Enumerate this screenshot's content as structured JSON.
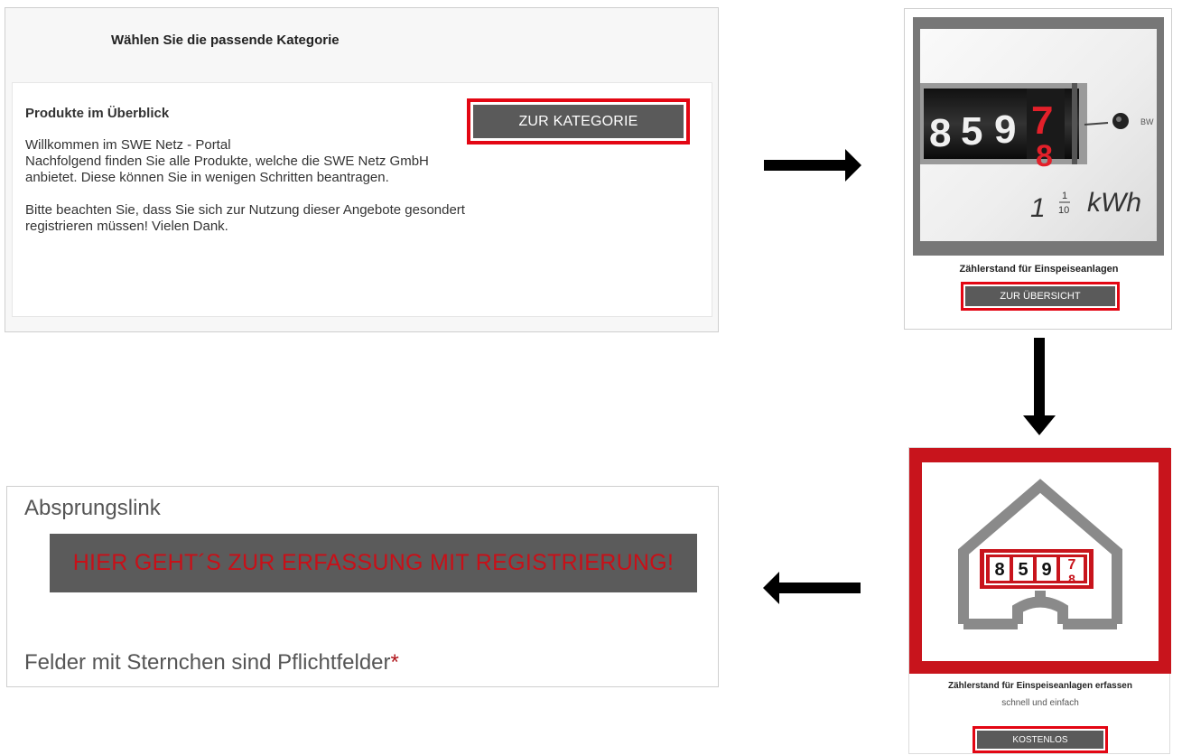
{
  "panel1": {
    "title": "Wählen Sie die passende Kategorie",
    "heading": "Produkte im Überblick",
    "body_line1": "Willkommen im SWE Netz - Portal",
    "body_line2": "Nachfolgend finden Sie alle Produkte, welche die SWE Netz GmbH anbietet. Diese können Sie in wenigen Schritten beantragen.",
    "body_para2": "Bitte beachten Sie, dass Sie sich zur Nutzung dieser Angebote gesondert registrieren müssen! Vielen Dank.",
    "button_label": "ZUR KATEGORIE"
  },
  "panel2": {
    "meter_digits": [
      "8",
      "5",
      "9",
      "7",
      "8"
    ],
    "meter_scale": [
      "1",
      "1",
      "10",
      "kWh"
    ],
    "caption": "Zählerstand für Einspeiseanlagen",
    "button_label": "ZUR ÜBERSICHT"
  },
  "panel3": {
    "meter_digits": [
      "8",
      "5",
      "9",
      "7",
      "8"
    ],
    "caption": "Zählerstand für Einspeiseanlagen erfassen",
    "subcaption": "schnell und einfach",
    "button_label": "KOSTENLOS"
  },
  "panel4": {
    "label": "Absprungslink",
    "link_text": "HIER GEHT´S ZUR ERFASSUNG MIT REGISTRIERUNG!",
    "note_text": "Felder mit Sternchen sind Pflichtfelder",
    "note_star": "*"
  },
  "colors": {
    "accent_red": "#e30613",
    "button_gray": "#5a5a5a",
    "link_text_red": "#c81018"
  },
  "icons": [
    "arrow-right-icon",
    "arrow-down-icon",
    "arrow-left-icon",
    "meter-photo",
    "house-meter-logo"
  ]
}
